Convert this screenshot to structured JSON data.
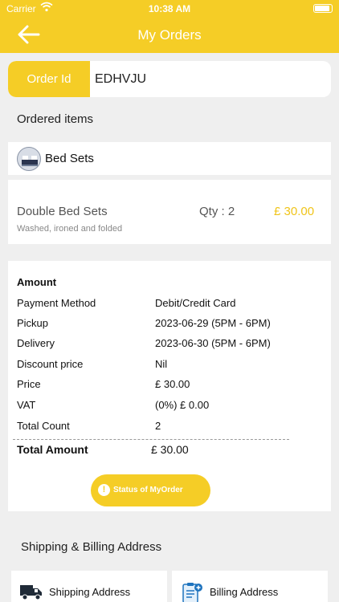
{
  "status_bar": {
    "carrier": "Carrier",
    "time": "10:38 AM"
  },
  "header": {
    "title": "My Orders",
    "back_icon": "arrow-left-icon"
  },
  "order": {
    "id_label": "Order Id",
    "id_value": "EDHVJU"
  },
  "ordered_items": {
    "section_title": "Ordered items",
    "category": {
      "name": "Bed Sets",
      "image_icon": "bed-image"
    },
    "items": [
      {
        "name": "Double Bed Sets",
        "service": "Washed, ironed and folded",
        "qty": "Qty : 2",
        "price": "£ 30.00"
      }
    ]
  },
  "amount": {
    "title": "Amount",
    "rows": [
      {
        "label": "Payment Method",
        "value": "Debit/Credit Card"
      },
      {
        "label": "Pickup",
        "value": "2023-06-29 (5PM - 6PM)"
      },
      {
        "label": "Delivery",
        "value": "2023-06-30 (5PM - 6PM)"
      },
      {
        "label": "Discount price",
        "value": "Nil"
      },
      {
        "label": "Price",
        "value": "£ 30.00"
      },
      {
        "label": "VAT",
        "value": "(0%) £ 0.00"
      },
      {
        "label": "Total Count",
        "value": "2"
      }
    ],
    "total_label": "Total Amount",
    "total_value": "£ 30.00",
    "status_button": "Status of MyOrder",
    "status_icon": "exclamation-icon"
  },
  "address": {
    "section_title": "Shipping & Billing Address",
    "shipping_label": "Shipping Address",
    "billing_label": "Billing Address"
  },
  "colors": {
    "accent": "#f5cd26",
    "price": "#f0c419",
    "background": "#efefef"
  }
}
